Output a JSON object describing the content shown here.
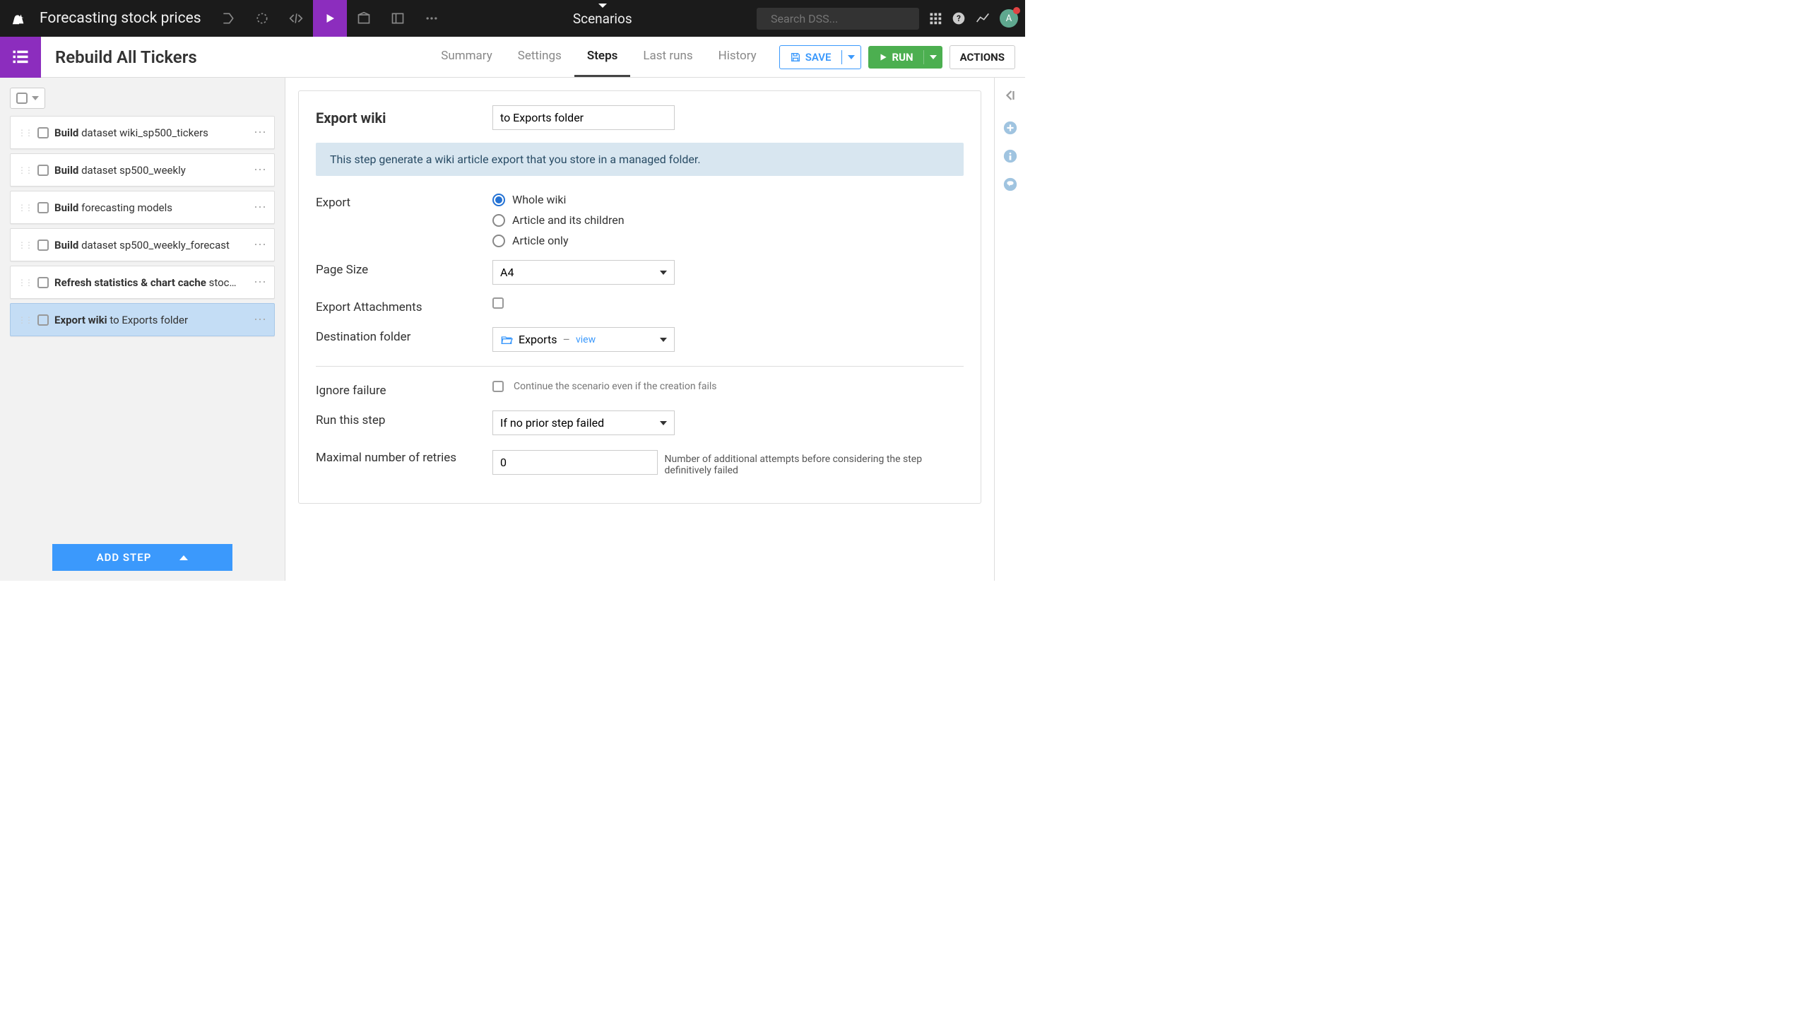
{
  "topbar": {
    "project_title": "Forecasting stock prices",
    "center_label": "Scenarios",
    "search_placeholder": "Search DSS...",
    "avatar_letter": "A"
  },
  "subheader": {
    "page_title": "Rebuild All Tickers",
    "tabs": [
      "Summary",
      "Settings",
      "Steps",
      "Last runs",
      "History"
    ],
    "active_tab": "Steps",
    "save_label": "SAVE",
    "run_label": "RUN",
    "actions_label": "ACTIONS"
  },
  "sidebar": {
    "steps": [
      {
        "bold": "Build",
        "rest": " dataset wiki_sp500_tickers",
        "selected": false
      },
      {
        "bold": "Build",
        "rest": " dataset sp500_weekly",
        "selected": false
      },
      {
        "bold": "Build",
        "rest": " forecasting models",
        "selected": false
      },
      {
        "bold": "Build",
        "rest": " dataset sp500_weekly_forecast",
        "selected": false
      },
      {
        "bold": "Refresh statistics & chart cache",
        "rest": " stoc…",
        "selected": false
      },
      {
        "bold": "Export wiki",
        "rest": " to Exports folder",
        "selected": true
      }
    ],
    "add_step_label": "ADD STEP"
  },
  "panel": {
    "title": "Export wiki",
    "name_value": "to Exports folder",
    "info_text": "This step generate a wiki article export that you store in a managed folder.",
    "export_label": "Export",
    "export_options": [
      "Whole wiki",
      "Article and its children",
      "Article only"
    ],
    "export_selected": "Whole wiki",
    "page_size_label": "Page Size",
    "page_size_value": "A4",
    "attachments_label": "Export Attachments",
    "dest_label": "Destination folder",
    "dest_value": "Exports",
    "dest_view": "view",
    "ignore_label": "Ignore failure",
    "ignore_hint": "Continue the scenario even if the creation fails",
    "run_step_label": "Run this step",
    "run_step_value": "If no prior step failed",
    "retries_label": "Maximal number of retries",
    "retries_value": "0",
    "retries_hint": "Number of additional attempts before considering the step definitively failed"
  }
}
